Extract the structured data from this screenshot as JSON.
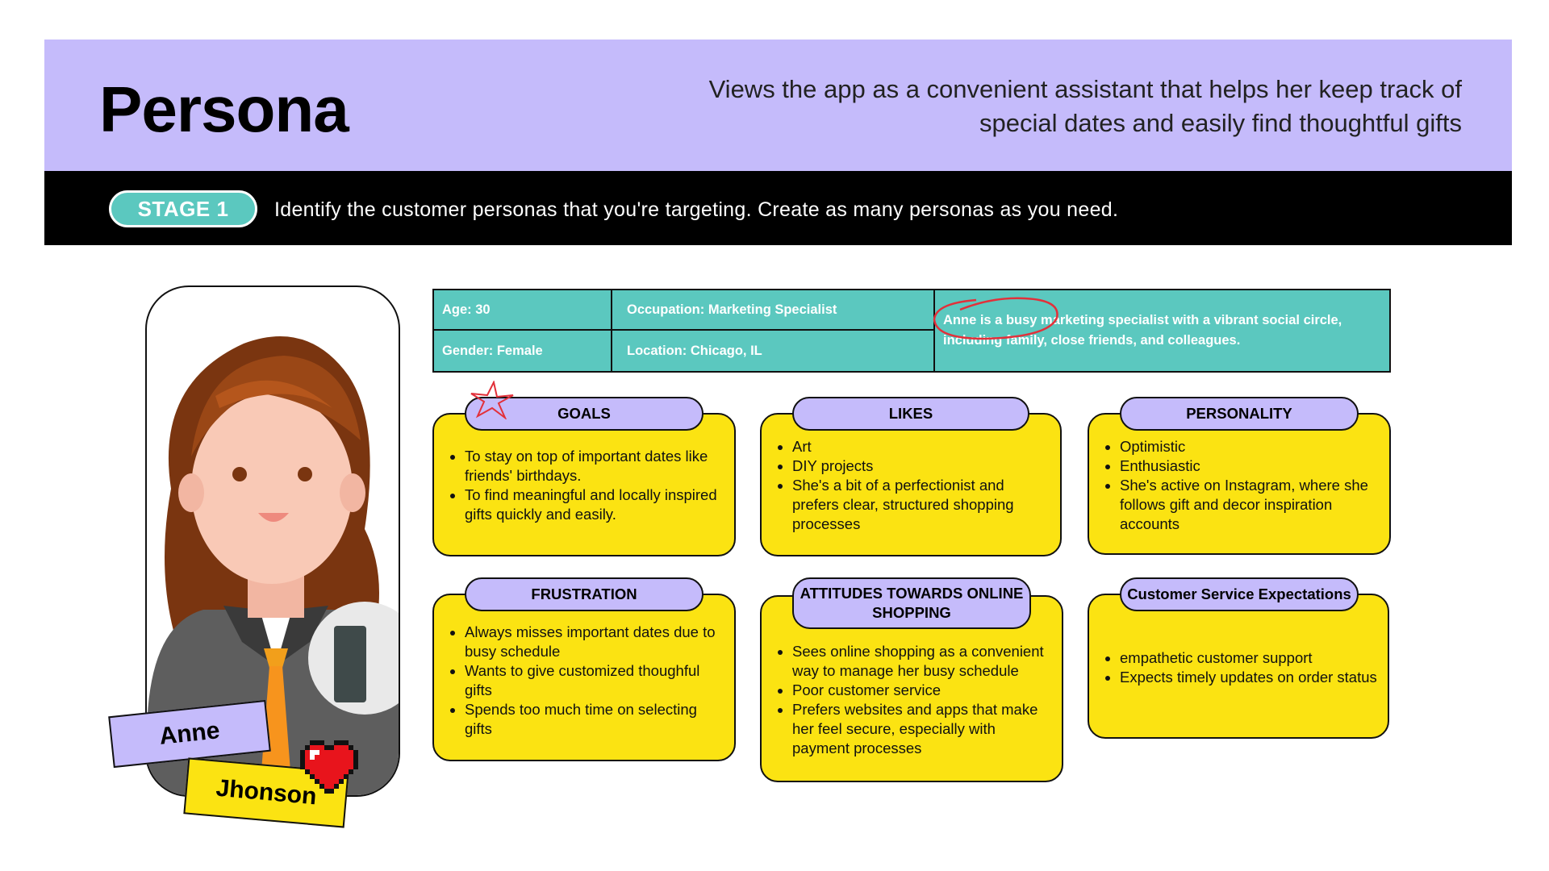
{
  "header": {
    "title": "Persona",
    "subtitle": "Views the app as a convenient assistant that helps her keep track of special dates and easily find thoughtful gifts"
  },
  "stage": {
    "badge": "STAGE 1",
    "instruction": "Identify the customer personas that you're targeting. Create as many personas as you need."
  },
  "persona": {
    "first_name": "Anne",
    "last_name": "Jhonson"
  },
  "info": {
    "age": "Age: 30",
    "gender": "Gender: Female",
    "occupation": "Occupation: Marketing Specialist",
    "location": "Location: Chicago, IL",
    "bio": "Anne is a busy marketing specialist with a vibrant social circle, including family, close friends, and colleagues."
  },
  "cards": {
    "goals": {
      "title": "GOALS",
      "items": [
        "To stay on top of important dates like friends' birthdays.",
        "To find meaningful and locally inspired gifts quickly and easily."
      ]
    },
    "likes": {
      "title": "LIKES",
      "items": [
        "Art",
        "DIY projects",
        "She's a bit of a perfectionist and prefers clear, structured shopping processes"
      ]
    },
    "personality": {
      "title": "PERSONALITY",
      "items": [
        "Optimistic",
        "Enthusiastic",
        "She's active on Instagram, where she follows gift and decor inspiration accounts"
      ]
    },
    "frustration": {
      "title": "FRUSTRATION",
      "items": [
        "Always misses important dates due to busy schedule",
        "Wants to give customized thoughful gifts",
        "Spends too much time on selecting gifts"
      ]
    },
    "attitudes": {
      "title": "ATTITUDES TOWARDS ONLINE SHOPPING",
      "items": [
        "Sees online shopping as a convenient way to manage her busy schedule",
        "Poor customer service",
        "Prefers websites and apps that make her feel secure, especially with payment processes"
      ]
    },
    "service": {
      "title": "Customer Service Expectations",
      "items": [
        "empathetic customer support",
        "Expects timely updates on order status"
      ]
    }
  },
  "colors": {
    "lavender": "#c5bbfb",
    "teal": "#5bc8bf",
    "yellow": "#fbe312",
    "black": "#000000"
  }
}
